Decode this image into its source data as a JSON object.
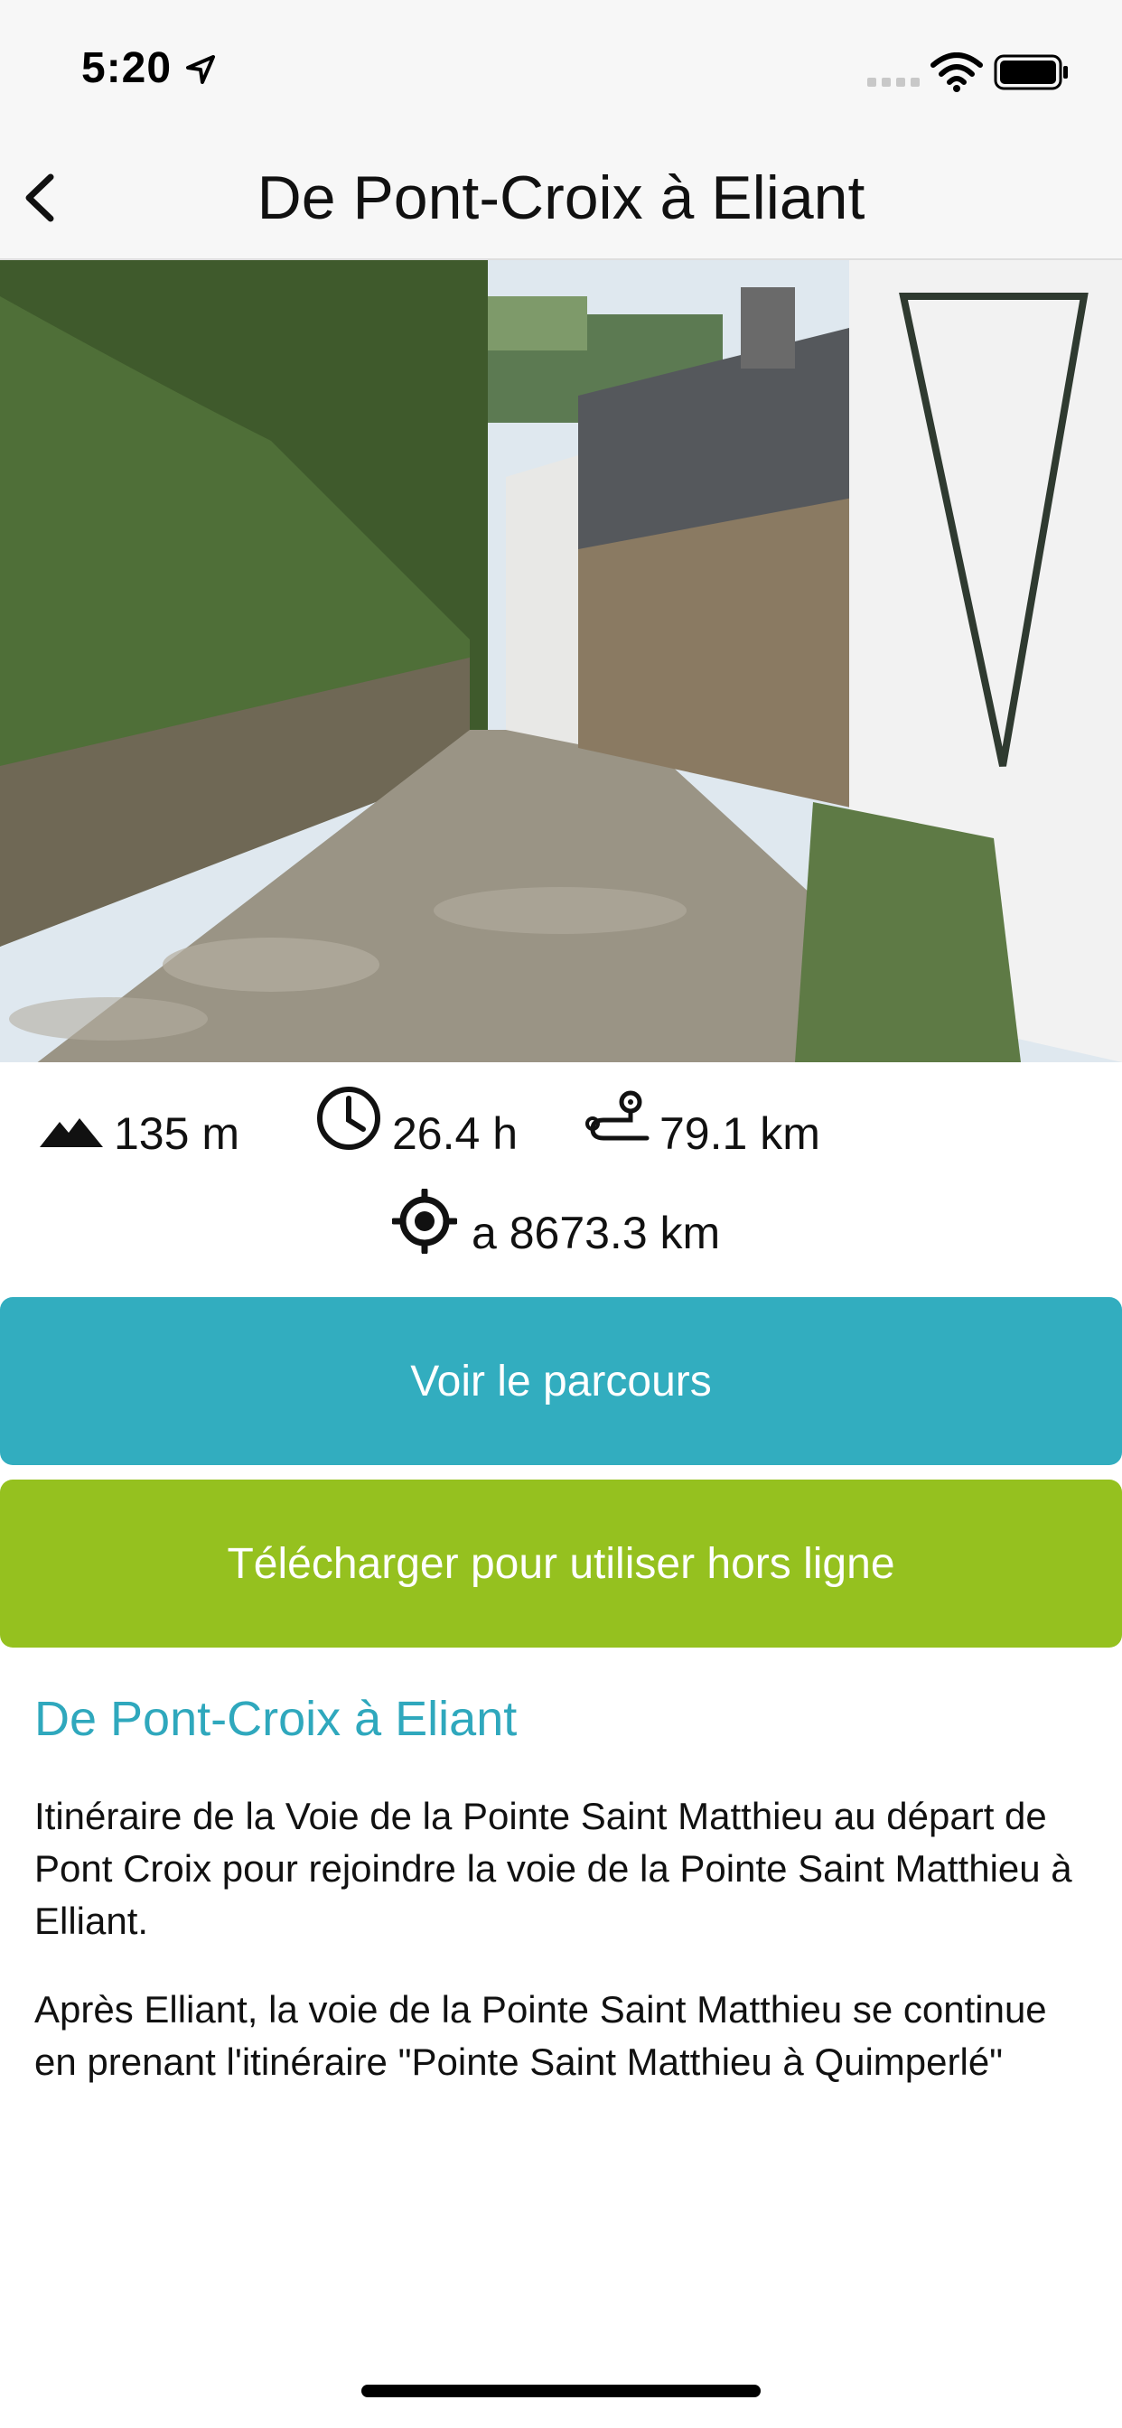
{
  "status_bar": {
    "time": "5:20"
  },
  "nav": {
    "title": "De Pont-Croix à Eliant",
    "back_icon": "chevron-left-icon"
  },
  "hero": {
    "icon": "photo",
    "colors": {
      "sky": "#dfe8ef",
      "wall": "#6f6855",
      "path": "#9a9485"
    }
  },
  "stats": {
    "elevation": "135 m",
    "duration": "26.4 h",
    "distance": "79.1 km",
    "location": "a 8673.3 km"
  },
  "buttons": {
    "route": "Voir le parcours",
    "download": "Télécharger pour utiliser hors ligne"
  },
  "description": {
    "title": "De Pont-Croix à Eliant",
    "paragraph1": "Itinéraire de la Voie de la Pointe Saint Matthieu au départ de Pont Croix pour rejoindre la voie de la Pointe Saint Matthieu à Elliant.",
    "paragraph2": "Après Elliant, la voie de la Pointe Saint Matthieu se continue en prenant l'itinéraire \"Pointe Saint Matthieu à Quimperlé\""
  },
  "colors": {
    "accent_blue": "#32adbf",
    "accent_green": "#95c11f"
  }
}
